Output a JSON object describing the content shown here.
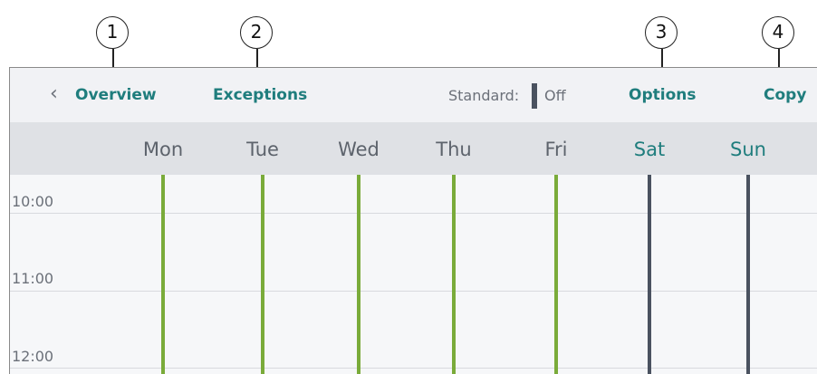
{
  "callouts": [
    "1",
    "2",
    "3",
    "4"
  ],
  "toolbar": {
    "back_icon": "chevron-left-icon",
    "overview": "Overview",
    "exceptions": "Exceptions",
    "standard_label": "Standard:",
    "standard_value": "Off",
    "options": "Options",
    "copy": "Copy"
  },
  "days": [
    "Mon",
    "Tue",
    "Wed",
    "Thu",
    "Fri",
    "Sat",
    "Sun"
  ],
  "times": [
    "10:00",
    "11:00",
    "12:00"
  ],
  "colors": {
    "accent": "#1f7d7d",
    "weekday_bar": "#7aab3a",
    "weekend_bar": "#4a5260",
    "toolbar_bg": "#f1f2f5",
    "header_bg": "#dfe1e5"
  }
}
